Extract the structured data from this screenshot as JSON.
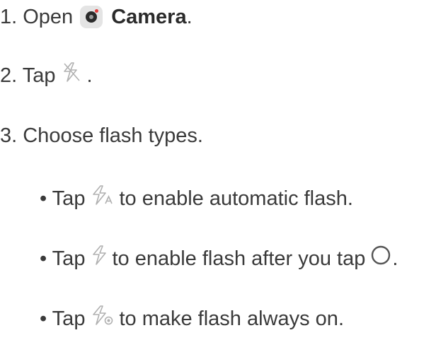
{
  "steps": [
    {
      "prefix": "1. Open",
      "app_name": "Camera",
      "suffix": "."
    },
    {
      "prefix": "2. Tap",
      "suffix": "."
    },
    {
      "text": "3. Choose flash types."
    }
  ],
  "bullets": [
    {
      "prefix": "• Tap",
      "text": "to enable automatic flash."
    },
    {
      "prefix": "• Tap",
      "text": "to enable flash after you tap",
      "suffix": "."
    },
    {
      "prefix": "• Tap",
      "text": "to make flash always on."
    }
  ],
  "icons": {
    "camera_app": "camera-app-icon",
    "flash_off": "flash-off-icon",
    "flash_auto": "flash-auto-icon",
    "flash_on": "flash-on-icon",
    "flash_always": "flash-always-on-icon",
    "shutter": "shutter-circle-icon"
  },
  "colors": {
    "text": "#3a3a3a",
    "icon_stroke": "#b0b0b0",
    "camera_dot": "#e03b3b"
  }
}
